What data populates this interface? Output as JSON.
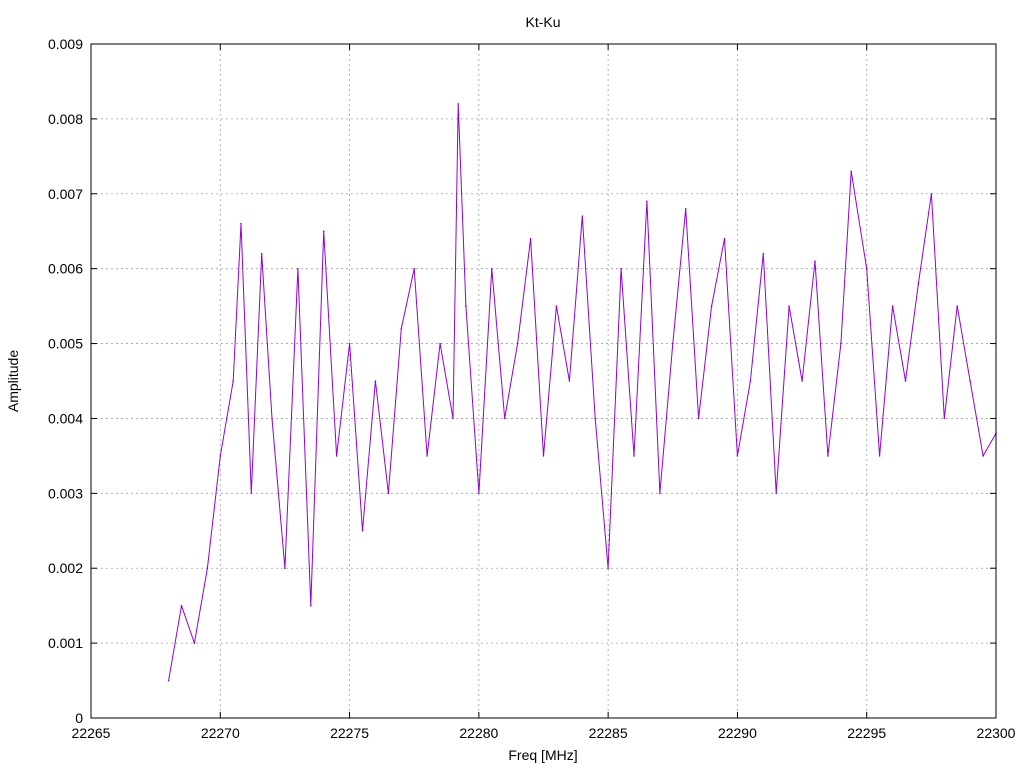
{
  "chart_data": {
    "type": "line",
    "title": "Kt-Ku",
    "xlabel": "Freq [MHz]",
    "ylabel": "Amplitude",
    "xlim": [
      22265,
      22300
    ],
    "ylim": [
      0,
      0.009
    ],
    "x_ticks": [
      "22265",
      "22270",
      "22275",
      "22280",
      "22285",
      "22290",
      "22295",
      "22300"
    ],
    "y_ticks": [
      "0",
      "0.001",
      "0.002",
      "0.003",
      "0.004",
      "0.005",
      "0.006",
      "0.007",
      "0.008",
      "0.009"
    ],
    "grid": true,
    "legend": "none",
    "series_color": "#9400d3",
    "series": [
      {
        "x": [
          22268.0,
          22268.5,
          22269.0,
          22269.5,
          22270.0,
          22270.5,
          22270.8,
          22271.2,
          22271.6,
          22272.0,
          22272.5,
          22273.0,
          22273.5,
          22274.0,
          22274.5,
          22275.0,
          22275.5,
          22276.0,
          22276.5,
          22277.0,
          22277.5,
          22278.0,
          22278.5,
          22279.0,
          22279.2,
          22279.5,
          22280.0,
          22280.5,
          22281.0,
          22281.5,
          22282.0,
          22282.5,
          22283.0,
          22283.5,
          22284.0,
          22284.5,
          22285.0,
          22285.5,
          22286.0,
          22286.5,
          22287.0,
          22287.5,
          22288.0,
          22288.5,
          22289.0,
          22289.5,
          22290.0,
          22290.5,
          22291.0,
          22291.5,
          22292.0,
          22292.5,
          22293.0,
          22293.5,
          22294.0,
          22294.4,
          22295.0,
          22295.5,
          22296.0,
          22296.5,
          22297.0,
          22297.5,
          22298.0,
          22298.5,
          22299.0,
          22299.5,
          22300.0
        ],
        "y": [
          0.0005,
          0.0015,
          0.001,
          0.002,
          0.0035,
          0.0045,
          0.0066,
          0.003,
          0.0062,
          0.004,
          0.002,
          0.006,
          0.0015,
          0.0065,
          0.0035,
          0.005,
          0.0025,
          0.0045,
          0.003,
          0.0052,
          0.006,
          0.0035,
          0.005,
          0.004,
          0.0082,
          0.0055,
          0.003,
          0.006,
          0.004,
          0.005,
          0.0064,
          0.0035,
          0.0055,
          0.0045,
          0.0067,
          0.004,
          0.002,
          0.006,
          0.0035,
          0.0069,
          0.003,
          0.005,
          0.0068,
          0.004,
          0.0055,
          0.0064,
          0.0035,
          0.0045,
          0.0062,
          0.003,
          0.0055,
          0.0045,
          0.0061,
          0.0035,
          0.005,
          0.0073,
          0.006,
          0.0035,
          0.0055,
          0.0045,
          0.0058,
          0.007,
          0.004,
          0.0055,
          0.0045,
          0.0035,
          0.0038
        ]
      }
    ]
  }
}
